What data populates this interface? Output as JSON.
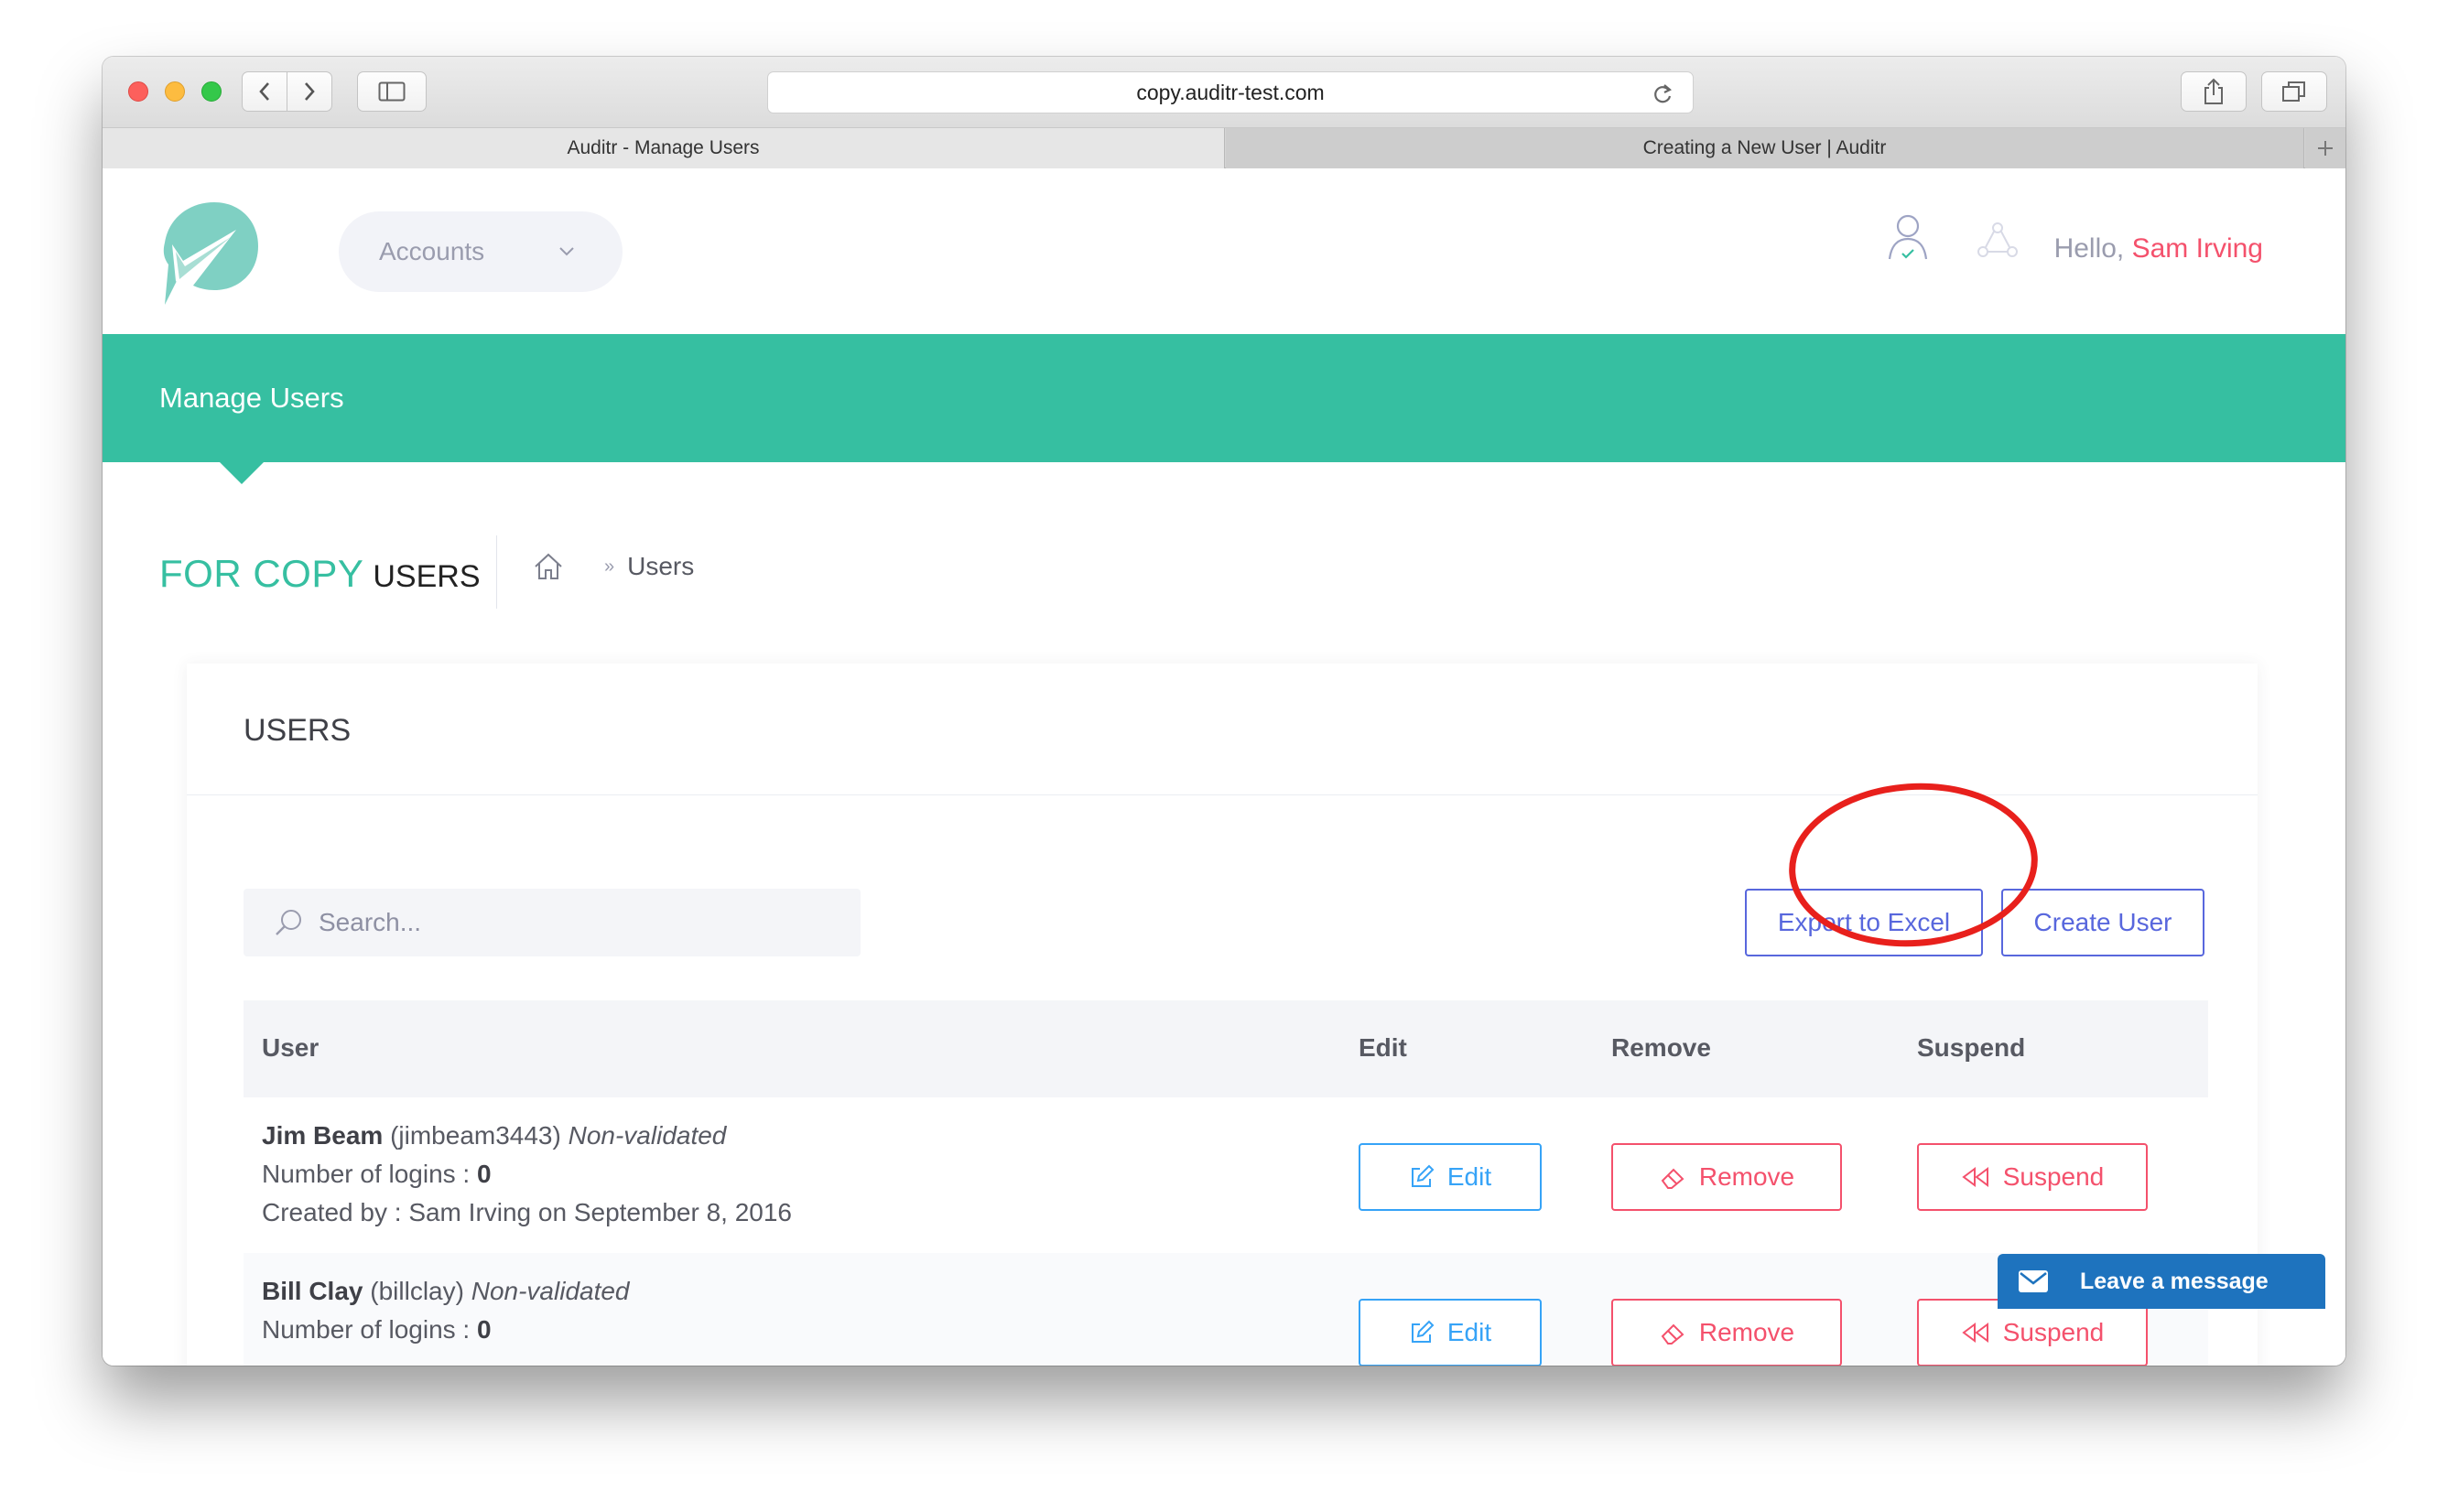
{
  "browser": {
    "url": "copy.auditr-test.com",
    "tabs": [
      {
        "label": "Auditr - Manage Users"
      },
      {
        "label": "Creating a New User | Auditr"
      }
    ]
  },
  "header": {
    "accounts_label": "Accounts",
    "greeting": "Hello, ",
    "user_name": "Sam Irving"
  },
  "band": {
    "title": "Manage Users"
  },
  "subheader": {
    "accent": "FOR COPY",
    "rest": "USERS",
    "breadcrumb_sep": "»",
    "breadcrumb_current": "Users"
  },
  "card": {
    "title": "USERS",
    "search_placeholder": "Search...",
    "export_label": "Export to Excel",
    "create_label": "Create User"
  },
  "table": {
    "columns": [
      "User",
      "Edit",
      "Remove",
      "Suspend"
    ],
    "logins_label": "Number of logins : ",
    "created_label": "Created by : ",
    "edit_label": "Edit",
    "remove_label": "Remove",
    "suspend_label": "Suspend",
    "rows": [
      {
        "name": "Jim Beam",
        "username": "(jimbeam3443)",
        "status": "Non-validated",
        "logins": "0",
        "created": "Sam Irving on September 8, 2016"
      },
      {
        "name": "Bill Clay",
        "username": "(billclay)",
        "status": "Non-validated",
        "logins": "0"
      }
    ]
  },
  "chat": {
    "label": "Leave a message"
  },
  "colors": {
    "brand": "#36bfa1",
    "primary": "#5867dd",
    "info": "#36a3f7",
    "danger": "#f4516c",
    "highlight_ring": "#e8201c",
    "chat": "#1e73be"
  }
}
